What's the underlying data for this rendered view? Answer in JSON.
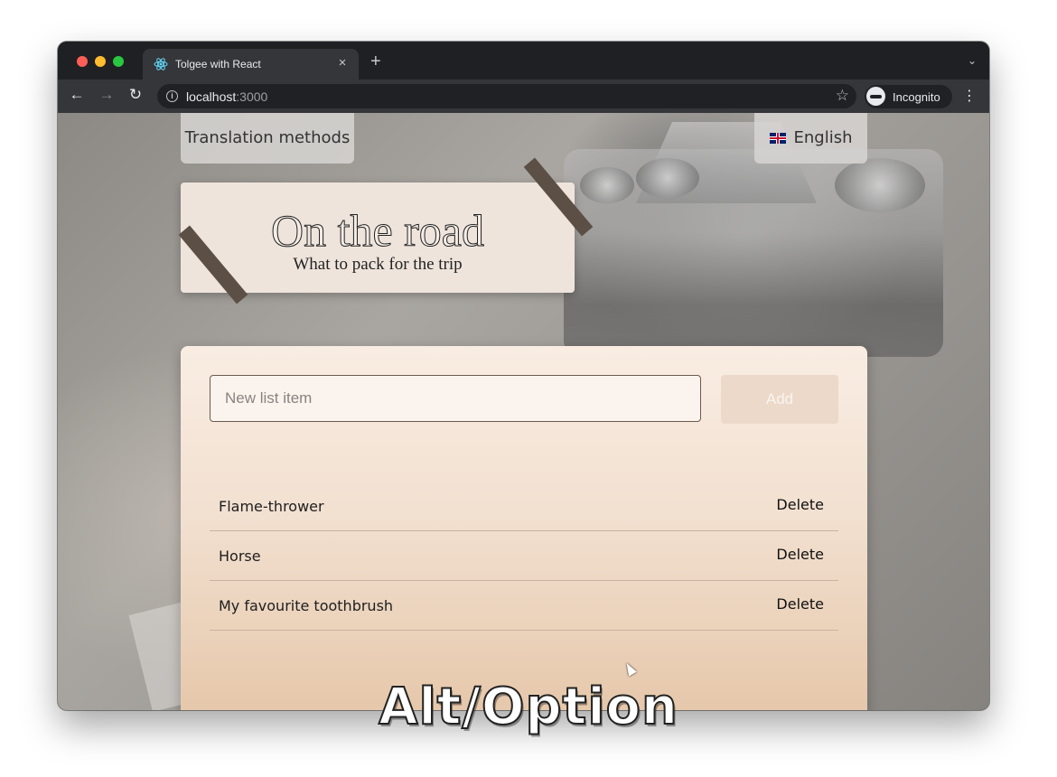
{
  "browser": {
    "tab_title": "Tolgee with React",
    "tab_close": "×",
    "new_tab": "+",
    "tab_menu": "⌄",
    "url_host": "localhost",
    "url_port": ":3000",
    "profile_label": "Incognito",
    "menu_icon": "⋮"
  },
  "page": {
    "methods_button": "Translation methods",
    "language_button": "English",
    "title": "On the road",
    "subtitle": "What to pack for the trip",
    "input_placeholder": "New list item",
    "add_label": "Add",
    "items": [
      {
        "text": "Flame-thrower",
        "delete": "Delete"
      },
      {
        "text": "Horse",
        "delete": "Delete"
      },
      {
        "text": "My favourite toothbrush",
        "delete": "Delete"
      }
    ]
  },
  "caption": "Alt/Option",
  "colors": {
    "card_bg": "#efe4dc",
    "tape": "#5c4f45",
    "add_button": "#ecd9ca"
  }
}
